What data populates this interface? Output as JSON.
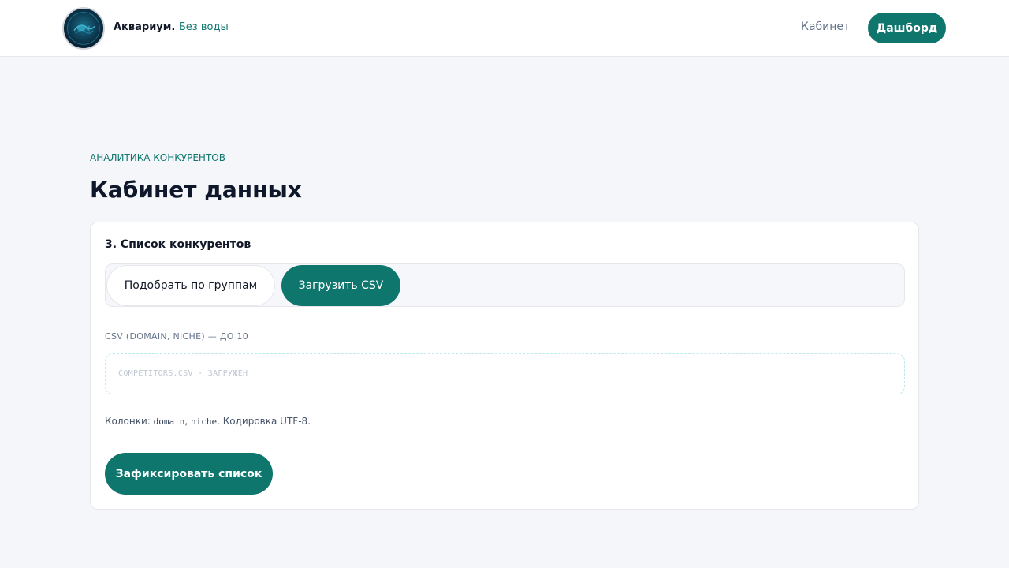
{
  "header": {
    "brand_name": "Аквариум.",
    "brand_accent": "Без воды",
    "nav_link": "Кабинет",
    "dashboard_button": "Дашборд"
  },
  "page": {
    "eyebrow": "АНАЛИТИКА КОНКУРЕНТОВ",
    "title": "Кабинет данных"
  },
  "card": {
    "title": "3. Список конкурентов",
    "segments": [
      {
        "label": "Подобрать по группам",
        "active": false
      },
      {
        "label": "Загрузить CSV",
        "active": true
      }
    ],
    "csv_label": "CSV (DOMAIN, NICHE) — ДО 10",
    "file_status": "COMPETITORS.CSV · ЗАГРУЖЕН",
    "hint": {
      "prefix": "Колонки: ",
      "col1": "domain",
      "sep": ", ",
      "col2": "niche",
      "suffix": ". Кодировка UTF-8."
    },
    "submit_button": "Зафиксировать список"
  },
  "icons": {
    "logo": "aquarium-logo-icon"
  },
  "colors": {
    "accent": "#0f766e",
    "background": "#f4f6f9",
    "surface": "#ffffff",
    "muted_text": "#64748b"
  }
}
